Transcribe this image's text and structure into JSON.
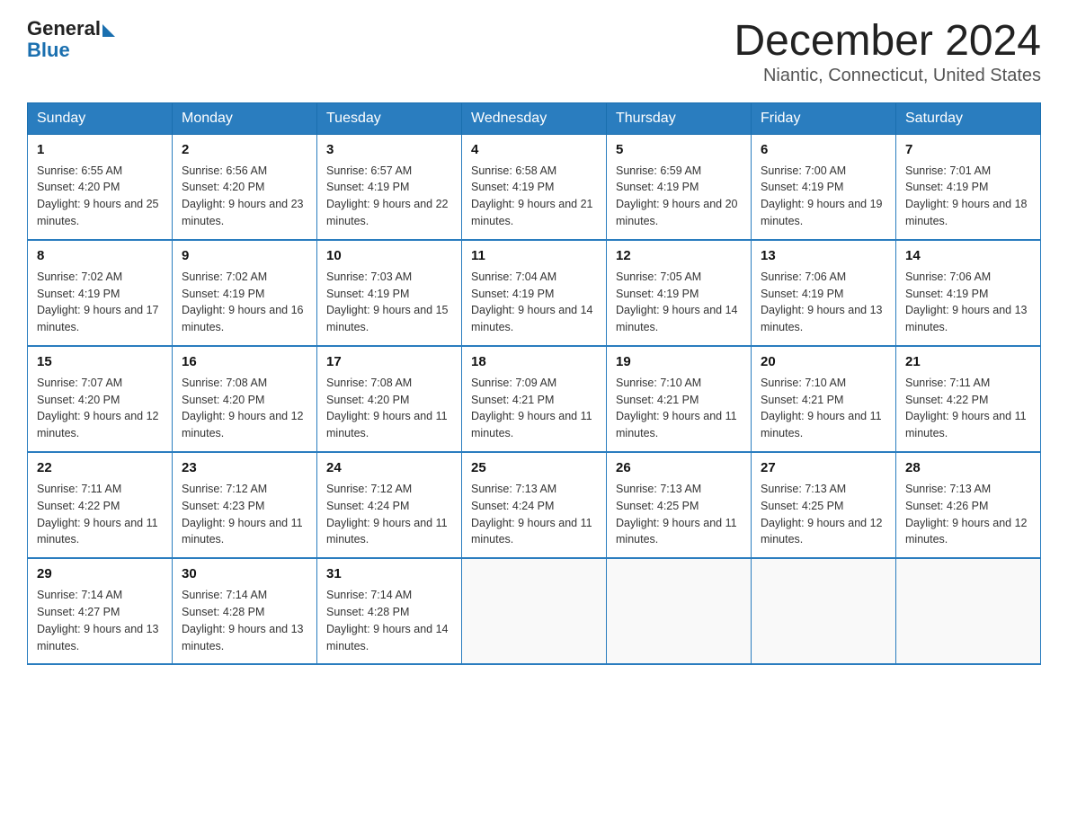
{
  "header": {
    "logo_text_general": "General",
    "logo_text_blue": "Blue",
    "title": "December 2024",
    "subtitle": "Niantic, Connecticut, United States"
  },
  "calendar": {
    "days_of_week": [
      "Sunday",
      "Monday",
      "Tuesday",
      "Wednesday",
      "Thursday",
      "Friday",
      "Saturday"
    ],
    "weeks": [
      [
        {
          "day": "1",
          "sunrise": "6:55 AM",
          "sunset": "4:20 PM",
          "daylight": "9 hours and 25 minutes."
        },
        {
          "day": "2",
          "sunrise": "6:56 AM",
          "sunset": "4:20 PM",
          "daylight": "9 hours and 23 minutes."
        },
        {
          "day": "3",
          "sunrise": "6:57 AM",
          "sunset": "4:19 PM",
          "daylight": "9 hours and 22 minutes."
        },
        {
          "day": "4",
          "sunrise": "6:58 AM",
          "sunset": "4:19 PM",
          "daylight": "9 hours and 21 minutes."
        },
        {
          "day": "5",
          "sunrise": "6:59 AM",
          "sunset": "4:19 PM",
          "daylight": "9 hours and 20 minutes."
        },
        {
          "day": "6",
          "sunrise": "7:00 AM",
          "sunset": "4:19 PM",
          "daylight": "9 hours and 19 minutes."
        },
        {
          "day": "7",
          "sunrise": "7:01 AM",
          "sunset": "4:19 PM",
          "daylight": "9 hours and 18 minutes."
        }
      ],
      [
        {
          "day": "8",
          "sunrise": "7:02 AM",
          "sunset": "4:19 PM",
          "daylight": "9 hours and 17 minutes."
        },
        {
          "day": "9",
          "sunrise": "7:02 AM",
          "sunset": "4:19 PM",
          "daylight": "9 hours and 16 minutes."
        },
        {
          "day": "10",
          "sunrise": "7:03 AM",
          "sunset": "4:19 PM",
          "daylight": "9 hours and 15 minutes."
        },
        {
          "day": "11",
          "sunrise": "7:04 AM",
          "sunset": "4:19 PM",
          "daylight": "9 hours and 14 minutes."
        },
        {
          "day": "12",
          "sunrise": "7:05 AM",
          "sunset": "4:19 PM",
          "daylight": "9 hours and 14 minutes."
        },
        {
          "day": "13",
          "sunrise": "7:06 AM",
          "sunset": "4:19 PM",
          "daylight": "9 hours and 13 minutes."
        },
        {
          "day": "14",
          "sunrise": "7:06 AM",
          "sunset": "4:19 PM",
          "daylight": "9 hours and 13 minutes."
        }
      ],
      [
        {
          "day": "15",
          "sunrise": "7:07 AM",
          "sunset": "4:20 PM",
          "daylight": "9 hours and 12 minutes."
        },
        {
          "day": "16",
          "sunrise": "7:08 AM",
          "sunset": "4:20 PM",
          "daylight": "9 hours and 12 minutes."
        },
        {
          "day": "17",
          "sunrise": "7:08 AM",
          "sunset": "4:20 PM",
          "daylight": "9 hours and 11 minutes."
        },
        {
          "day": "18",
          "sunrise": "7:09 AM",
          "sunset": "4:21 PM",
          "daylight": "9 hours and 11 minutes."
        },
        {
          "day": "19",
          "sunrise": "7:10 AM",
          "sunset": "4:21 PM",
          "daylight": "9 hours and 11 minutes."
        },
        {
          "day": "20",
          "sunrise": "7:10 AM",
          "sunset": "4:21 PM",
          "daylight": "9 hours and 11 minutes."
        },
        {
          "day": "21",
          "sunrise": "7:11 AM",
          "sunset": "4:22 PM",
          "daylight": "9 hours and 11 minutes."
        }
      ],
      [
        {
          "day": "22",
          "sunrise": "7:11 AM",
          "sunset": "4:22 PM",
          "daylight": "9 hours and 11 minutes."
        },
        {
          "day": "23",
          "sunrise": "7:12 AM",
          "sunset": "4:23 PM",
          "daylight": "9 hours and 11 minutes."
        },
        {
          "day": "24",
          "sunrise": "7:12 AM",
          "sunset": "4:24 PM",
          "daylight": "9 hours and 11 minutes."
        },
        {
          "day": "25",
          "sunrise": "7:13 AM",
          "sunset": "4:24 PM",
          "daylight": "9 hours and 11 minutes."
        },
        {
          "day": "26",
          "sunrise": "7:13 AM",
          "sunset": "4:25 PM",
          "daylight": "9 hours and 11 minutes."
        },
        {
          "day": "27",
          "sunrise": "7:13 AM",
          "sunset": "4:25 PM",
          "daylight": "9 hours and 12 minutes."
        },
        {
          "day": "28",
          "sunrise": "7:13 AM",
          "sunset": "4:26 PM",
          "daylight": "9 hours and 12 minutes."
        }
      ],
      [
        {
          "day": "29",
          "sunrise": "7:14 AM",
          "sunset": "4:27 PM",
          "daylight": "9 hours and 13 minutes."
        },
        {
          "day": "30",
          "sunrise": "7:14 AM",
          "sunset": "4:28 PM",
          "daylight": "9 hours and 13 minutes."
        },
        {
          "day": "31",
          "sunrise": "7:14 AM",
          "sunset": "4:28 PM",
          "daylight": "9 hours and 14 minutes."
        },
        null,
        null,
        null,
        null
      ]
    ]
  }
}
